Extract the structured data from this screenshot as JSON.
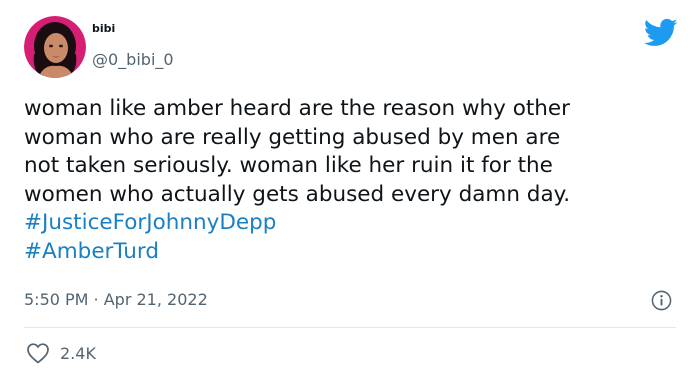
{
  "author": {
    "display_name": "bibi",
    "handle": "@0_bibi_0"
  },
  "tweet": {
    "lines": [
      "woman like amber heard are the reason why other",
      "woman who are really getting abused by men are",
      "not taken seriously. woman like her ruin it for the",
      "women who actually gets abused every damn day."
    ],
    "hashtags": [
      "#JusticeForJohnnyDepp",
      "#AmberTurd"
    ],
    "timestamp": "5:50 PM · Apr 21, 2022"
  },
  "engagement": {
    "likes": "2.4K"
  },
  "colors": {
    "brand": "#1d9bf0",
    "link": "#1b7fc4",
    "muted_text": "#536471",
    "avatar_bg": "#d61f74"
  },
  "icons": [
    "twitter-bird-icon",
    "info-icon",
    "heart-icon"
  ]
}
